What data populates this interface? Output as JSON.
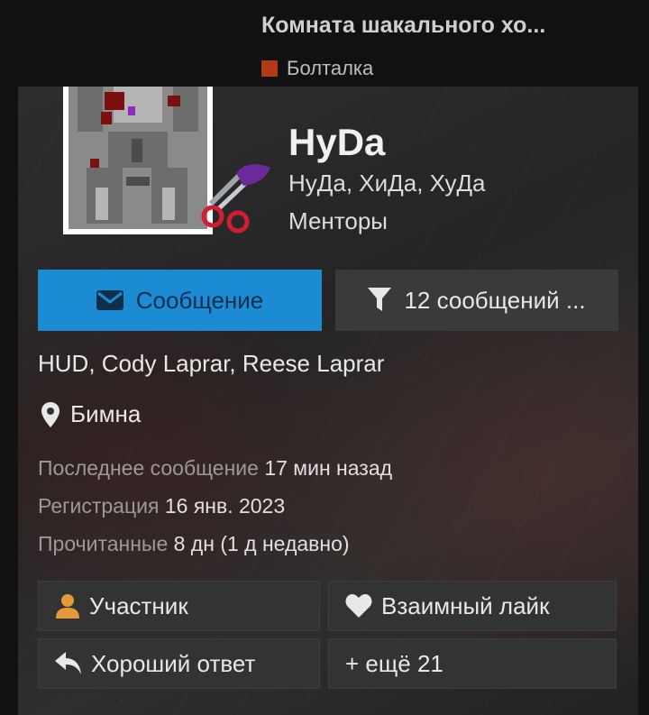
{
  "background_thread": {
    "title": "Комната шакального хо...",
    "forum": "Болталка",
    "forum_color": "#b23a16"
  },
  "profile": {
    "username": "HyDa",
    "user_title": "НуДа, ХиДа, ХуДа",
    "group": "Менторы",
    "aliases": "HUD, Cody Laprar, Reese Laprar",
    "location": "Бимна",
    "stats": {
      "last_message_label": "Последнее сообщение",
      "last_message_value": "17 мин назад",
      "registered_label": "Регистрация",
      "registered_value": "16 янв. 2023",
      "read_label": "Прочитанные",
      "read_value": "8 дн (1 д недавно)"
    }
  },
  "actions": {
    "message_label": "Сообщение",
    "message_icon": "envelope-icon",
    "message_color": "#1b8bd4",
    "posts_label": "12 сообщений ...",
    "posts_icon": "filter-icon"
  },
  "trophies": [
    {
      "label": "Участник",
      "icon": "user-icon",
      "color": "#e59a3a"
    },
    {
      "label": "Взаимный лайк",
      "icon": "heart-icon"
    },
    {
      "label": "Хороший ответ",
      "icon": "reply-icon"
    },
    {
      "label": "+ ещё 21",
      "icon": ""
    }
  ]
}
